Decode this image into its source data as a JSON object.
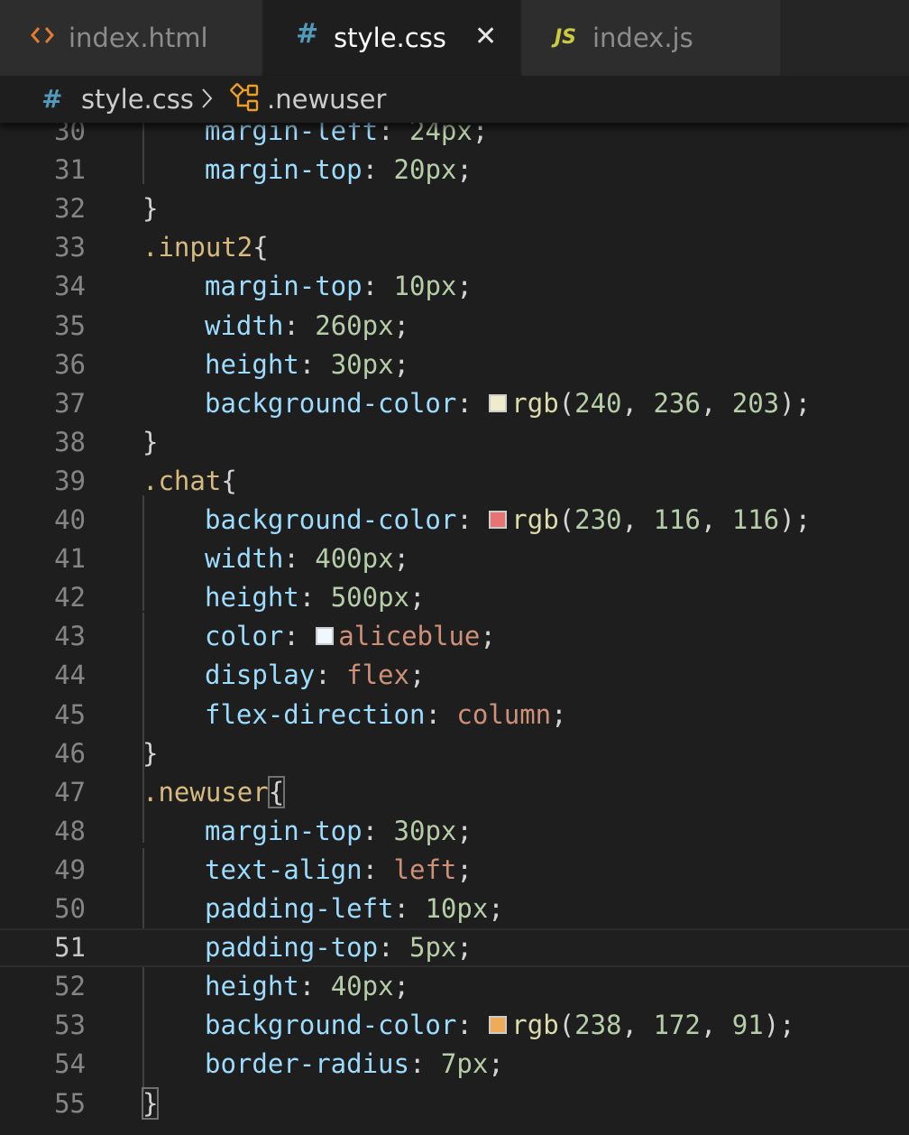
{
  "tabs": [
    {
      "label": "index.html",
      "icon": "code-icon",
      "icon_glyph": "<>",
      "icon_color": "#e37933",
      "active": false
    },
    {
      "label": "style.css",
      "icon": "hash-icon",
      "icon_glyph": "#",
      "icon_color": "#519aba",
      "active": true,
      "close_glyph": "✕"
    },
    {
      "label": "index.js",
      "icon": "js-icon",
      "icon_glyph": "JS",
      "icon_color": "#cbcb41",
      "active": false
    }
  ],
  "breadcrumb": {
    "icon_glyph": "#",
    "file": "style.css",
    "separator": "chevron-right-icon",
    "symbol_icon": "css-class-symbol-icon",
    "symbol": ".newuser"
  },
  "editor": {
    "current_line": "51",
    "lines": [
      {
        "n": "30",
        "tokens": [
          [
            "prop",
            "margin-left"
          ],
          [
            "p",
            ": "
          ],
          [
            "num",
            "24px"
          ],
          [
            "p",
            ";"
          ]
        ]
      },
      {
        "n": "31",
        "tokens": [
          [
            "prop",
            "margin-top"
          ],
          [
            "p",
            ": "
          ],
          [
            "num",
            "20px"
          ],
          [
            "p",
            ";"
          ]
        ]
      },
      {
        "n": "32",
        "tokens": [
          [
            "p",
            "}"
          ]
        ]
      },
      {
        "n": "33",
        "tokens": [
          [
            "sel",
            ".input2"
          ],
          [
            "p",
            "{"
          ]
        ]
      },
      {
        "n": "34",
        "tokens": [
          [
            "prop",
            "margin-top"
          ],
          [
            "p",
            ": "
          ],
          [
            "num",
            "10px"
          ],
          [
            "p",
            ";"
          ]
        ]
      },
      {
        "n": "35",
        "tokens": [
          [
            "prop",
            "width"
          ],
          [
            "p",
            ": "
          ],
          [
            "num",
            "260px"
          ],
          [
            "p",
            ";"
          ]
        ]
      },
      {
        "n": "36",
        "tokens": [
          [
            "prop",
            "height"
          ],
          [
            "p",
            ": "
          ],
          [
            "num",
            "30px"
          ],
          [
            "p",
            ";"
          ]
        ]
      },
      {
        "n": "37",
        "tokens": [
          [
            "prop",
            "background-color"
          ],
          [
            "p",
            ": "
          ],
          [
            "swatch",
            "#f0eccb"
          ],
          [
            "fn",
            "rgb"
          ],
          [
            "p",
            "("
          ],
          [
            "num",
            "240"
          ],
          [
            "p",
            ", "
          ],
          [
            "num",
            "236"
          ],
          [
            "p",
            ", "
          ],
          [
            "num",
            "203"
          ],
          [
            "p",
            ");"
          ]
        ]
      },
      {
        "n": "38",
        "tokens": [
          [
            "p",
            "}"
          ]
        ]
      },
      {
        "n": "39",
        "tokens": [
          [
            "sel",
            ".chat"
          ],
          [
            "p",
            "{"
          ]
        ]
      },
      {
        "n": "40",
        "tokens": [
          [
            "prop",
            "background-color"
          ],
          [
            "p",
            ": "
          ],
          [
            "swatch",
            "#e67474"
          ],
          [
            "fn",
            "rgb"
          ],
          [
            "p",
            "("
          ],
          [
            "num",
            "230"
          ],
          [
            "p",
            ", "
          ],
          [
            "num",
            "116"
          ],
          [
            "p",
            ", "
          ],
          [
            "num",
            "116"
          ],
          [
            "p",
            ");"
          ]
        ]
      },
      {
        "n": "41",
        "tokens": [
          [
            "prop",
            "width"
          ],
          [
            "p",
            ": "
          ],
          [
            "num",
            "400px"
          ],
          [
            "p",
            ";"
          ]
        ]
      },
      {
        "n": "42",
        "tokens": [
          [
            "prop",
            "height"
          ],
          [
            "p",
            ": "
          ],
          [
            "num",
            "500px"
          ],
          [
            "p",
            ";"
          ]
        ]
      },
      {
        "n": "43",
        "tokens": [
          [
            "prop",
            "color"
          ],
          [
            "p",
            ": "
          ],
          [
            "swatch",
            "#f0f8ff"
          ],
          [
            "kw",
            "aliceblue"
          ],
          [
            "p",
            ";"
          ]
        ]
      },
      {
        "n": "44",
        "tokens": [
          [
            "prop",
            "display"
          ],
          [
            "p",
            ": "
          ],
          [
            "kw",
            "flex"
          ],
          [
            "p",
            ";"
          ]
        ]
      },
      {
        "n": "45",
        "tokens": [
          [
            "prop",
            "flex-direction"
          ],
          [
            "p",
            ": "
          ],
          [
            "kw",
            "column"
          ],
          [
            "p",
            ";"
          ]
        ]
      },
      {
        "n": "46",
        "tokens": [
          [
            "p",
            "}"
          ]
        ]
      },
      {
        "n": "47",
        "tokens": [
          [
            "sel",
            ".newuser"
          ],
          [
            "bm",
            "{"
          ]
        ]
      },
      {
        "n": "48",
        "tokens": [
          [
            "prop",
            "margin-top"
          ],
          [
            "p",
            ": "
          ],
          [
            "num",
            "30px"
          ],
          [
            "p",
            ";"
          ]
        ]
      },
      {
        "n": "49",
        "tokens": [
          [
            "prop",
            "text-align"
          ],
          [
            "p",
            ": "
          ],
          [
            "kw",
            "left"
          ],
          [
            "p",
            ";"
          ]
        ]
      },
      {
        "n": "50",
        "tokens": [
          [
            "prop",
            "padding-left"
          ],
          [
            "p",
            ": "
          ],
          [
            "num",
            "10px"
          ],
          [
            "p",
            ";"
          ]
        ]
      },
      {
        "n": "51",
        "tokens": [
          [
            "prop",
            "padding-top"
          ],
          [
            "p",
            ": "
          ],
          [
            "num",
            "5px"
          ],
          [
            "p",
            ";"
          ]
        ]
      },
      {
        "n": "52",
        "tokens": [
          [
            "prop",
            "height"
          ],
          [
            "p",
            ": "
          ],
          [
            "num",
            "40px"
          ],
          [
            "p",
            ";"
          ]
        ]
      },
      {
        "n": "53",
        "tokens": [
          [
            "prop",
            "background-color"
          ],
          [
            "p",
            ": "
          ],
          [
            "swatch",
            "#eeac5b"
          ],
          [
            "fn",
            "rgb"
          ],
          [
            "p",
            "("
          ],
          [
            "num",
            "238"
          ],
          [
            "p",
            ", "
          ],
          [
            "num",
            "172"
          ],
          [
            "p",
            ", "
          ],
          [
            "num",
            "91"
          ],
          [
            "p",
            ");"
          ]
        ]
      },
      {
        "n": "54",
        "tokens": [
          [
            "prop",
            "border-radius"
          ],
          [
            "p",
            ": "
          ],
          [
            "num",
            "7px"
          ],
          [
            "p",
            ";"
          ]
        ]
      },
      {
        "n": "55",
        "tokens": [
          [
            "bm",
            "}"
          ]
        ]
      }
    ]
  }
}
